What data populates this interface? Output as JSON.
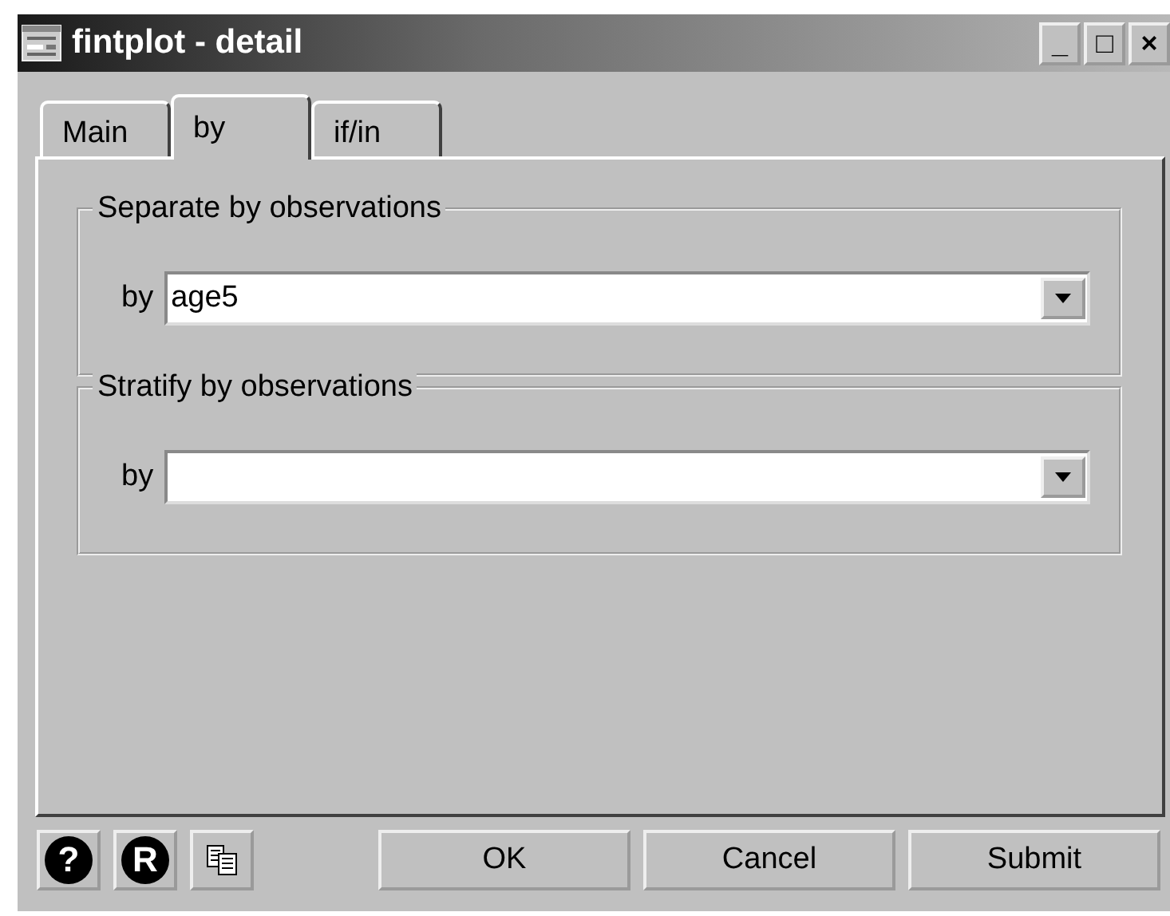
{
  "window": {
    "title": "fintplot - detail",
    "controls": [
      "_",
      "□",
      "×"
    ]
  },
  "tabs": [
    {
      "label": "Main",
      "selected": false
    },
    {
      "label": "by",
      "selected": true
    },
    {
      "label": "if/in",
      "selected": false
    }
  ],
  "groups": [
    {
      "title": "Separate by observations",
      "label": "by",
      "value": "age5"
    },
    {
      "title": "Stratify by observations",
      "label": "by"
    }
  ],
  "tool_buttons": [
    "?",
    "R"
  ],
  "buttons": [
    "OK",
    "Cancel",
    "Submit"
  ]
}
